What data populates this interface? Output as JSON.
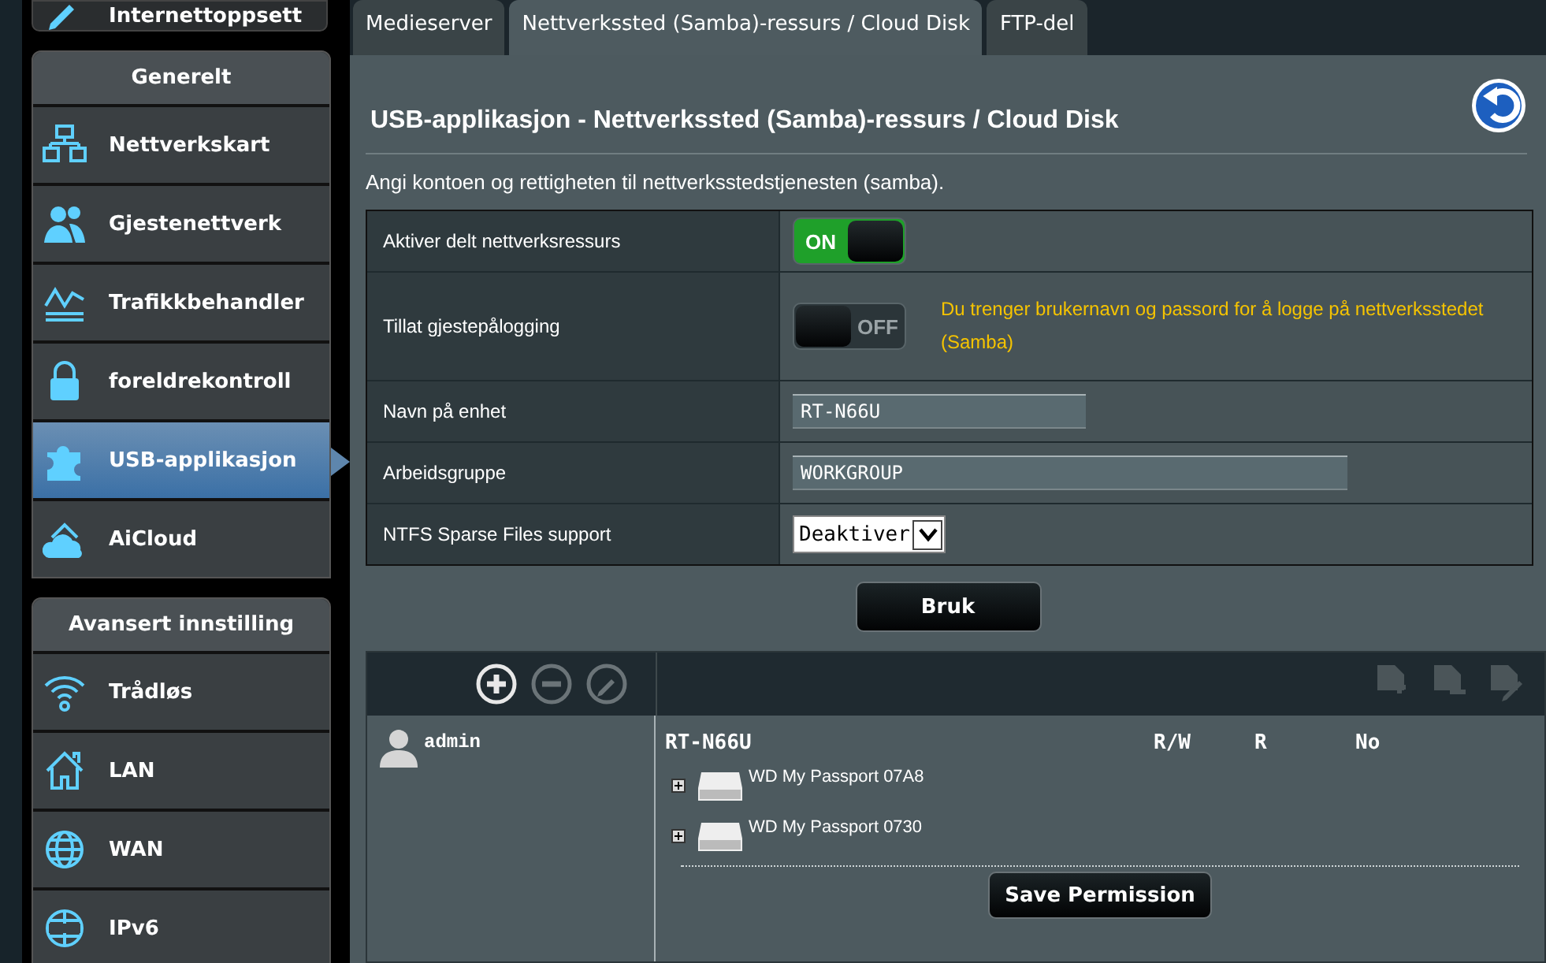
{
  "sidebar": {
    "top_item": {
      "label": "Internettoppsett"
    },
    "sections": [
      {
        "title": "Generelt",
        "items": [
          {
            "label": "Nettverkskart",
            "selected": false
          },
          {
            "label": "Gjestenettverk",
            "selected": false
          },
          {
            "label": "Trafikkbehandler",
            "selected": false
          },
          {
            "label": "foreldrekontroll",
            "selected": false
          },
          {
            "label": "USB-applikasjon",
            "selected": true
          },
          {
            "label": "AiCloud",
            "selected": false
          }
        ]
      },
      {
        "title": "Avansert innstilling",
        "items": [
          {
            "label": "Trådløs",
            "selected": false
          },
          {
            "label": "LAN",
            "selected": false
          },
          {
            "label": "WAN",
            "selected": false
          },
          {
            "label": "IPv6",
            "selected": false
          }
        ]
      }
    ]
  },
  "tabs": [
    {
      "label": "Medieserver",
      "selected": false
    },
    {
      "label": "Nettverkssted (Samba)-ressurs / Cloud Disk",
      "selected": true
    },
    {
      "label": "FTP-del",
      "selected": false
    }
  ],
  "page": {
    "title": "USB-applikasjon - Nettverkssted (Samba)-ressurs / Cloud Disk",
    "description": "Angi kontoen og rettigheten til nettverksstedstjenesten (samba).",
    "settings": [
      {
        "kind": "toggle",
        "label": "Aktiver delt nettverksressurs",
        "toggle_text": "ON",
        "on": true
      },
      {
        "kind": "toggle",
        "label": "Tillat gjestepålogging",
        "toggle_text": "OFF",
        "on": false,
        "note": "Du trenger brukernavn og passord for å logge på nettverksstedet (Samba)"
      },
      {
        "kind": "text",
        "label": "Navn på enhet",
        "value": "RT-N66U"
      },
      {
        "kind": "text",
        "label": "Arbeidsgruppe",
        "value": "WORKGROUP"
      },
      {
        "kind": "select",
        "label": "NTFS Sparse Files support",
        "value": "Deaktiver"
      }
    ],
    "apply_button": "Bruk"
  },
  "permissions": {
    "account_tools": [
      {
        "disabled": false
      },
      {
        "disabled": true
      },
      {
        "disabled": true
      }
    ],
    "folder_tools": [
      {
        "disabled": true
      },
      {
        "disabled": true
      },
      {
        "disabled": true
      }
    ],
    "accounts": [
      {
        "name": "admin"
      }
    ],
    "device": "RT-N66U",
    "columns": [
      "R/W",
      "R",
      "No"
    ],
    "drives": [
      {
        "name": "WD My Passport 07A8",
        "expanded": false
      },
      {
        "name": "WD My Passport 0730",
        "expanded": false
      }
    ],
    "save_button": "Save Permission"
  }
}
